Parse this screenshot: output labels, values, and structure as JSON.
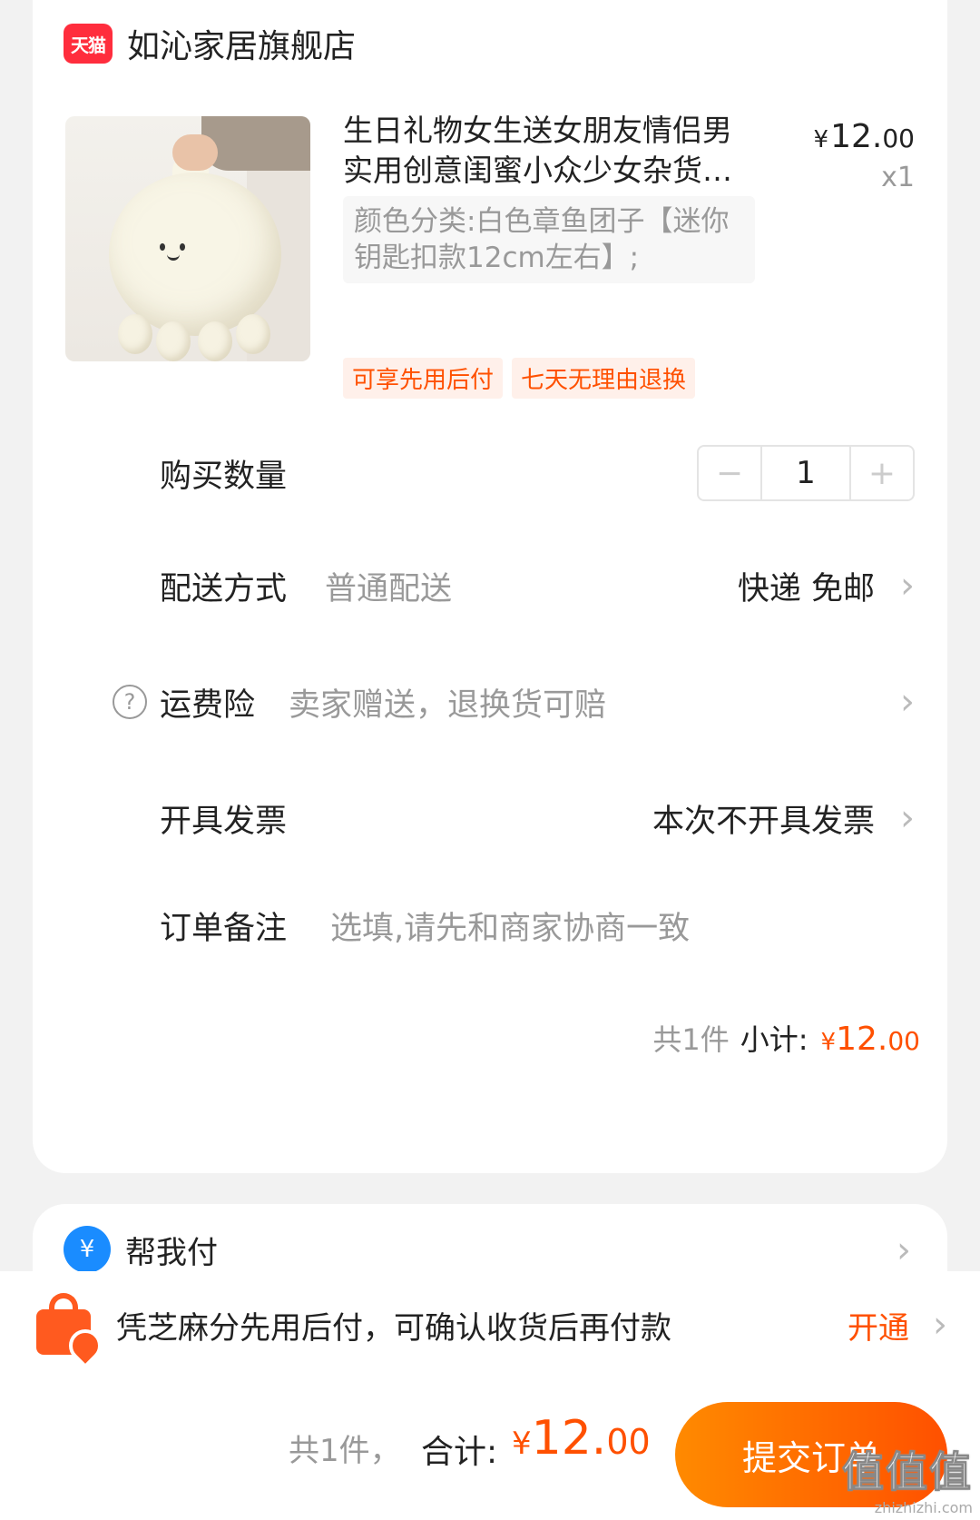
{
  "store": {
    "logo_text": "天猫",
    "name": "如沁家居旗舰店"
  },
  "product": {
    "title": "生日礼物女生送女朋友情侣男实用创意闺蜜小众少女杂货…",
    "price_yen": "¥",
    "price_int": "12.",
    "price_dec": "00",
    "quantity_label": "x1",
    "sku": "颜色分类:白色章鱼团子【迷你钥匙扣款12cm左右】;",
    "tags": [
      "可享先用后付",
      "七天无理由退换"
    ]
  },
  "rows": {
    "quantity": {
      "label": "购买数量",
      "minus": "−",
      "value": "1",
      "plus": "+"
    },
    "delivery": {
      "label": "配送方式",
      "value": "普通配送",
      "right": "快递 免邮"
    },
    "insurance": {
      "icon": "?",
      "label": "运费险",
      "value": "卖家赠送，退换货可赔"
    },
    "invoice": {
      "label": "开具发票",
      "right": "本次不开具发票"
    },
    "note": {
      "label": "订单备注",
      "placeholder": "选填,请先和商家协商一致"
    }
  },
  "subtotal": {
    "count": "共1件",
    "label": "小计:",
    "yen": "¥",
    "int": "12.",
    "dec": "00"
  },
  "helpme": {
    "icon": "¥",
    "label": "帮我付"
  },
  "banner": {
    "text": "凭芝麻分先用后付，可确认收货后再付款",
    "action": "开通"
  },
  "footer": {
    "count": "共1件，",
    "total_label": "合计:",
    "yen": "¥",
    "int": "12.",
    "dec": "00",
    "submit": "提交订单"
  },
  "watermark": {
    "big": "值值值",
    "small": "zhizhizhi.com"
  },
  "icons": {
    "chevron": "chevron-right-icon",
    "help": "question-circle-icon",
    "bag": "shopping-bag-icon",
    "pay": "alipay-icon"
  },
  "colors": {
    "accent": "#ff5000",
    "tmall_red": "#ff2d3d",
    "alipay_blue": "#1a8cff"
  }
}
